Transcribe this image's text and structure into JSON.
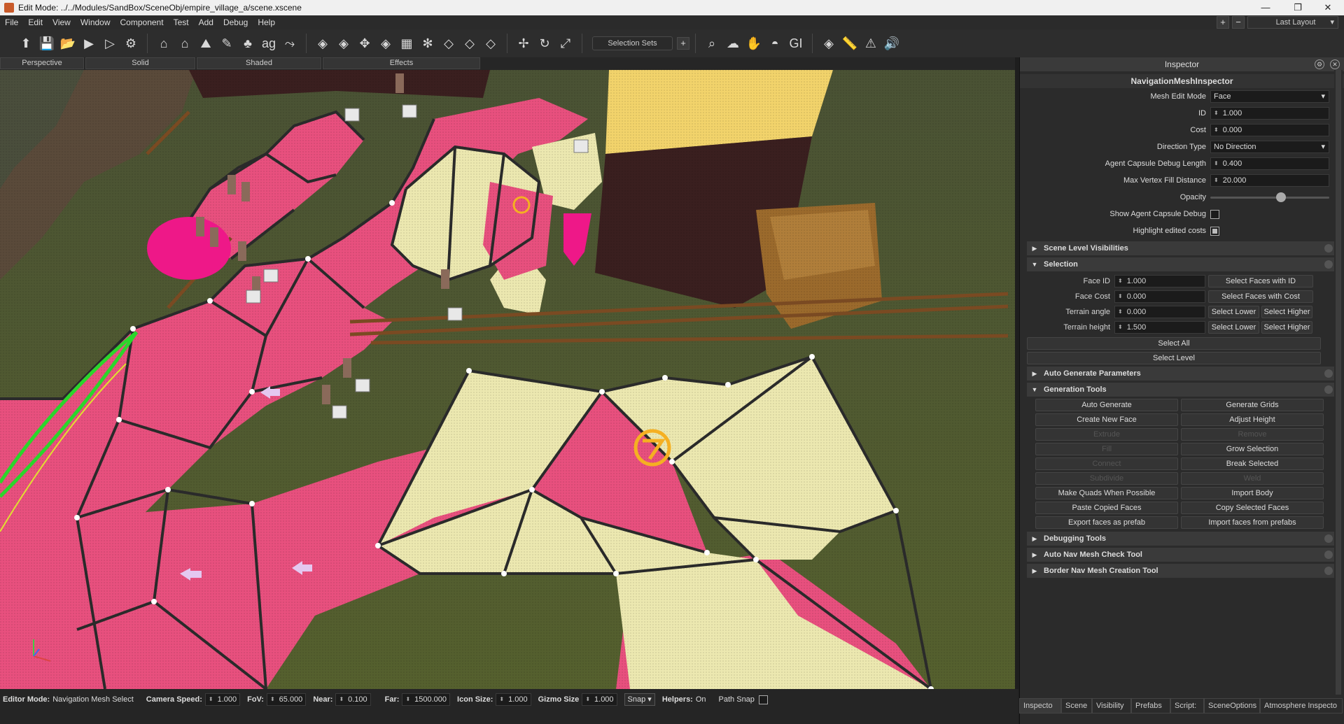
{
  "window": {
    "title": "Edit Mode: ../../Modules/SandBox/SceneObj/empire_village_a/scene.xscene",
    "minimize": "—",
    "maximize": "❐",
    "close": "✕"
  },
  "menu": [
    "File",
    "Edit",
    "View",
    "Window",
    "Component",
    "Test",
    "Add",
    "Debug",
    "Help"
  ],
  "layout": {
    "plus": "+",
    "minus": "−",
    "current": "Last Layout"
  },
  "toolbar": {
    "selection_sets": "Selection Sets",
    "add": "+"
  },
  "viewport_tabs": [
    "Perspective",
    "Solid",
    "Shaded",
    "Effects"
  ],
  "status": {
    "editor_mode_label": "Editor Mode:",
    "editor_mode_value": "Navigation Mesh Select",
    "camera_speed_label": "Camera Speed:",
    "camera_speed": "1.000",
    "fov_label": "FoV:",
    "fov": "65.000",
    "near_label": "Near:",
    "near": "0.100",
    "far_label": "Far:",
    "far": "1500.000",
    "icon_size_label": "Icon Size:",
    "icon_size": "1.000",
    "gizmo_size_label": "Gizmo Size",
    "gizmo_size": "1.000",
    "snap": "Snap",
    "helpers_label": "Helpers:",
    "helpers_value": "On",
    "path_snap": "Path Snap"
  },
  "inspector": {
    "title": "Inspector",
    "subtitle": "NavigationMeshInspector",
    "props": {
      "mesh_edit_mode_label": "Mesh Edit Mode",
      "mesh_edit_mode": "Face",
      "id_label": "ID",
      "id": "1.000",
      "cost_label": "Cost",
      "cost": "0.000",
      "direction_type_label": "Direction Type",
      "direction_type": "No Direction",
      "agent_capsule_label": "Agent Capsule Debug Length",
      "agent_capsule": "0.400",
      "max_vertex_label": "Max Vertex Fill Distance",
      "max_vertex": "20.000",
      "opacity_label": "Opacity",
      "opacity": 0.6,
      "show_capsule_label": "Show Agent Capsule Debug",
      "show_capsule": false,
      "highlight_costs_label": "Highlight edited costs",
      "highlight_costs": true
    },
    "sections": {
      "scene_level": "Scene Level Visibilities",
      "selection": "Selection",
      "auto_generate": "Auto Generate Parameters",
      "generation_tools": "Generation Tools",
      "debugging": "Debugging Tools",
      "auto_nav_check": "Auto Nav Mesh Check Tool",
      "border_nav": "Border Nav Mesh Creation Tool"
    },
    "selection": {
      "face_id_label": "Face ID",
      "face_id": "1.000",
      "face_cost_label": "Face Cost",
      "face_cost": "0.000",
      "terrain_angle_label": "Terrain angle",
      "terrain_angle": "0.000",
      "terrain_height_label": "Terrain height",
      "terrain_height": "1.500",
      "select_faces_id": "Select Faces with ID",
      "select_faces_cost": "Select Faces with Cost",
      "select_lower": "Select Lower",
      "select_higher": "Select Higher",
      "select_all": "Select All",
      "select_level": "Select Level"
    },
    "gen_buttons": [
      "Auto Generate",
      "Generate Grids",
      "Create New Face",
      "Adjust Height",
      "Extrude",
      "Remove",
      "Fill",
      "Grow Selection",
      "Connect",
      "Break Selected",
      "Subdivide",
      "Weld",
      "Make Quads When Possible",
      "Import Body",
      "Paste Copied Faces",
      "Copy Selected Faces",
      "Export faces as prefab",
      "Import faces from prefabs"
    ],
    "gen_disabled": [
      4,
      5,
      6,
      8,
      10,
      11
    ]
  },
  "bottom_tabs": [
    "Inspecto",
    "Scene",
    "Visibility",
    "Prefabs",
    "Script:",
    "SceneOptions",
    "Atmosphere Inspecto"
  ],
  "colors": {
    "nav_pink": "#e8507e",
    "nav_yellow": "#ece8b0",
    "grass": "#4d5a2e"
  }
}
